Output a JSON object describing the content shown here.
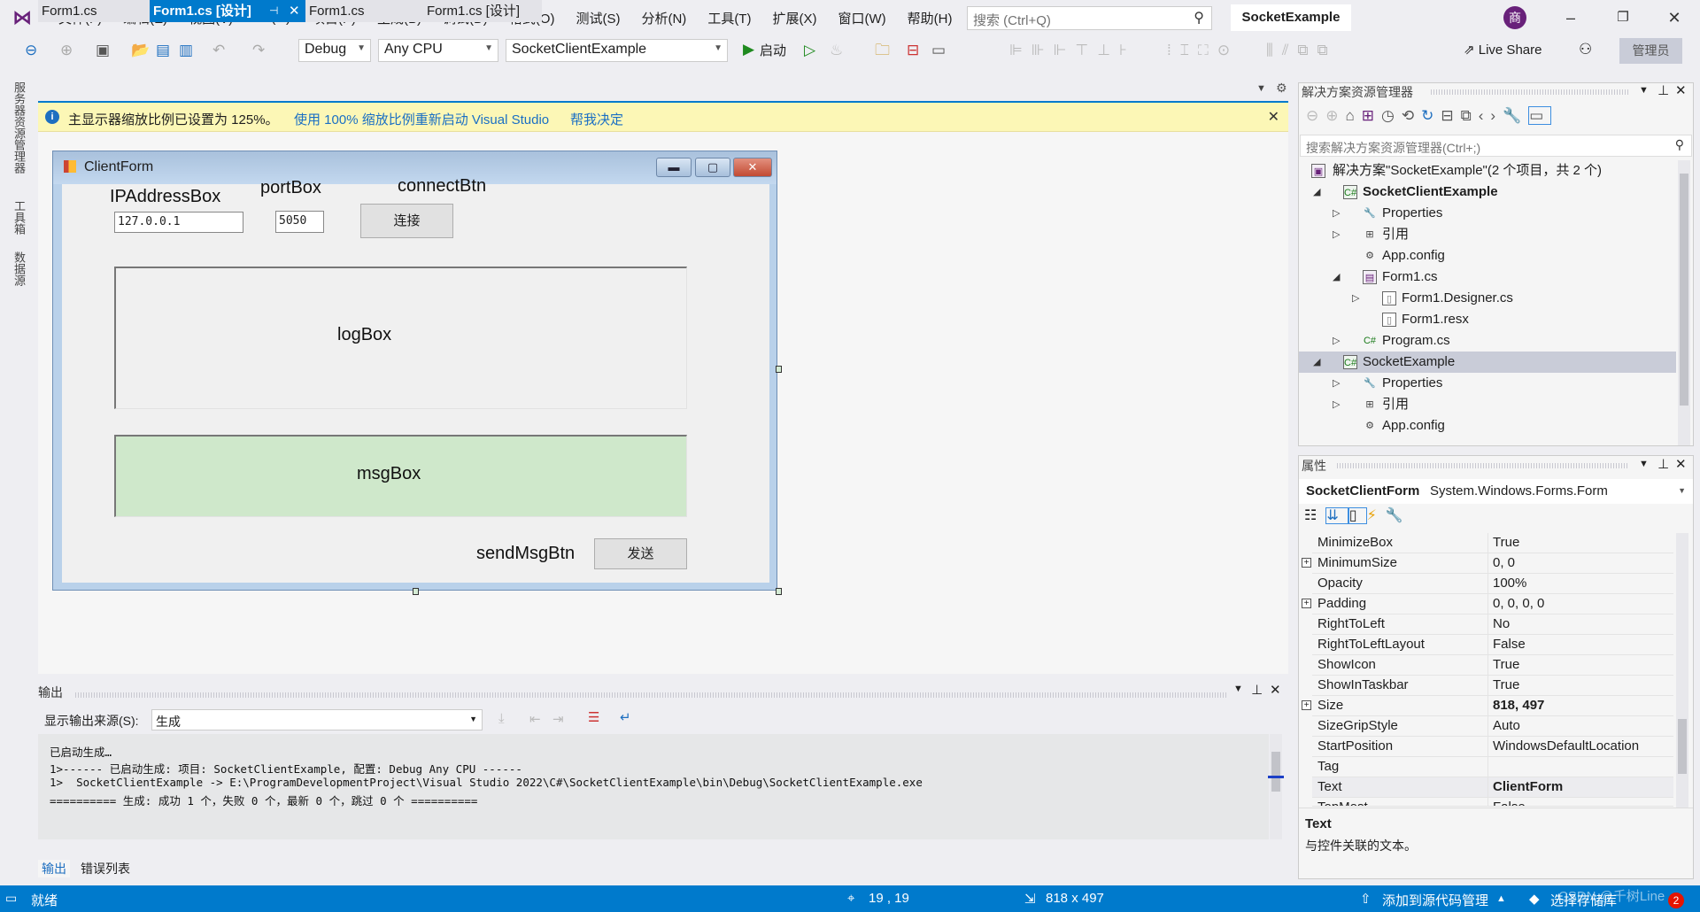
{
  "title_bar": {
    "menu": [
      "文件(F)",
      "编辑(E)",
      "视图(V)",
      "Git(G)",
      "项目(P)",
      "生成(B)",
      "调试(D)",
      "格式(O)",
      "测试(S)",
      "分析(N)",
      "工具(T)",
      "扩展(X)",
      "窗口(W)",
      "帮助(H)"
    ],
    "search_placeholder": "搜索 (Ctrl+Q)",
    "solution_name": "SocketExample",
    "avatar_initial": "商"
  },
  "toolbar": {
    "config": "Debug",
    "platform": "Any CPU",
    "startup_project": "SocketClientExample",
    "start_label": "启动",
    "live_share": "Live Share",
    "admin_label": "管理员"
  },
  "left_strip": [
    "服务器资源管理器",
    "工具箱",
    "数据源"
  ],
  "tabs": [
    {
      "label": "Form1.cs",
      "active": false
    },
    {
      "label": "Form1.cs [设计]",
      "active": true
    },
    {
      "label": "Form1.cs",
      "active": false
    },
    {
      "label": "Form1.cs [设计]",
      "active": false
    }
  ],
  "info_bar": {
    "message": "主显示器缩放比例已设置为 125%。",
    "link1": "使用 100% 缩放比例重新启动 Visual Studio",
    "link2": "帮我决定"
  },
  "designer": {
    "form_title": "ClientForm",
    "ip_label": "IPAddressBox",
    "ip_value": "127.0.0.1",
    "port_label": "portBox",
    "port_value": "5050",
    "connect_label": "connectBtn",
    "connect_button": "连接",
    "logbox_label": "logBox",
    "msgbox_label": "msgBox",
    "send_label": "sendMsgBtn",
    "send_button": "发送",
    "msgbox_color": "#cfe8cb"
  },
  "output": {
    "title": "输出",
    "source_label": "显示输出来源(S):",
    "source_value": "生成",
    "lines": [
      "已启动生成…",
      "1>------ 已启动生成: 项目: SocketClientExample, 配置: Debug Any CPU ------",
      "1>  SocketClientExample -> E:\\ProgramDevelopmentProject\\Visual Studio 2022\\C#\\SocketClientExample\\bin\\Debug\\SocketClientExample.exe",
      "========== 生成: 成功 1 个，失败 0 个，最新 0 个，跳过 0 个 =========="
    ],
    "bottom_tabs": [
      "输出",
      "错误列表"
    ]
  },
  "solution_explorer": {
    "title": "解决方案资源管理器",
    "search_placeholder": "搜索解决方案资源管理器(Ctrl+;)",
    "items": [
      {
        "label": "解决方案\"SocketExample\"(2 个项目，共 2 个)",
        "level": 0,
        "icon": "solution-icon",
        "expander": "",
        "bold": false
      },
      {
        "label": "SocketClientExample",
        "level": 1,
        "icon": "csharp-project-icon",
        "expander": "expanded",
        "bold": true
      },
      {
        "label": "Properties",
        "level": 2,
        "icon": "wrench-icon",
        "expander": "collapsed"
      },
      {
        "label": "引用",
        "level": 2,
        "icon": "references-icon",
        "expander": "collapsed"
      },
      {
        "label": "App.config",
        "level": 2,
        "icon": "config-file-icon",
        "expander": ""
      },
      {
        "label": "Form1.cs",
        "level": 2,
        "icon": "form-icon",
        "expander": "expanded"
      },
      {
        "label": "Form1.Designer.cs",
        "level": 3,
        "icon": "file-icon",
        "expander": "collapsed"
      },
      {
        "label": "Form1.resx",
        "level": 3,
        "icon": "file-icon",
        "expander": ""
      },
      {
        "label": "Program.cs",
        "level": 2,
        "icon": "csharp-file-icon",
        "expander": "collapsed"
      },
      {
        "label": "SocketExample",
        "level": 1,
        "icon": "csharp-project-icon",
        "expander": "expanded",
        "selected": true
      },
      {
        "label": "Properties",
        "level": 2,
        "icon": "wrench-icon",
        "expander": "collapsed"
      },
      {
        "label": "引用",
        "level": 2,
        "icon": "references-icon",
        "expander": "collapsed"
      },
      {
        "label": "App.config",
        "level": 2,
        "icon": "config-file-icon",
        "expander": ""
      }
    ]
  },
  "properties": {
    "title": "属性",
    "object_name": "SocketClientForm",
    "object_type": "System.Windows.Forms.Form",
    "rows": [
      {
        "name": "MinimizeBox",
        "value": "True"
      },
      {
        "name": "MinimumSize",
        "value": "0, 0",
        "expandable": true
      },
      {
        "name": "Opacity",
        "value": "100%"
      },
      {
        "name": "Padding",
        "value": "0, 0, 0, 0",
        "expandable": true
      },
      {
        "name": "RightToLeft",
        "value": "No"
      },
      {
        "name": "RightToLeftLayout",
        "value": "False"
      },
      {
        "name": "ShowIcon",
        "value": "True"
      },
      {
        "name": "ShowInTaskbar",
        "value": "True"
      },
      {
        "name": "Size",
        "value": "818, 497",
        "expandable": true,
        "bold": true
      },
      {
        "name": "SizeGripStyle",
        "value": "Auto"
      },
      {
        "name": "StartPosition",
        "value": "WindowsDefaultLocation"
      },
      {
        "name": "Tag",
        "value": ""
      },
      {
        "name": "Text",
        "value": "ClientForm",
        "bold": true,
        "selected": true
      },
      {
        "name": "TopMost",
        "value": "False"
      }
    ],
    "desc_title": "Text",
    "desc_text": "与控件关联的文本。"
  },
  "status_bar": {
    "ready": "就绪",
    "position": "19 , 19",
    "size": "818 x 497",
    "source_control": "添加到源代码管理",
    "repo": "选择存储库",
    "notifications": "2",
    "watermark": "CSDN @千树Line"
  },
  "colors": {
    "accent": "#007acc",
    "vs_purple": "#68217a",
    "info_bar": "#fcf7b6"
  }
}
